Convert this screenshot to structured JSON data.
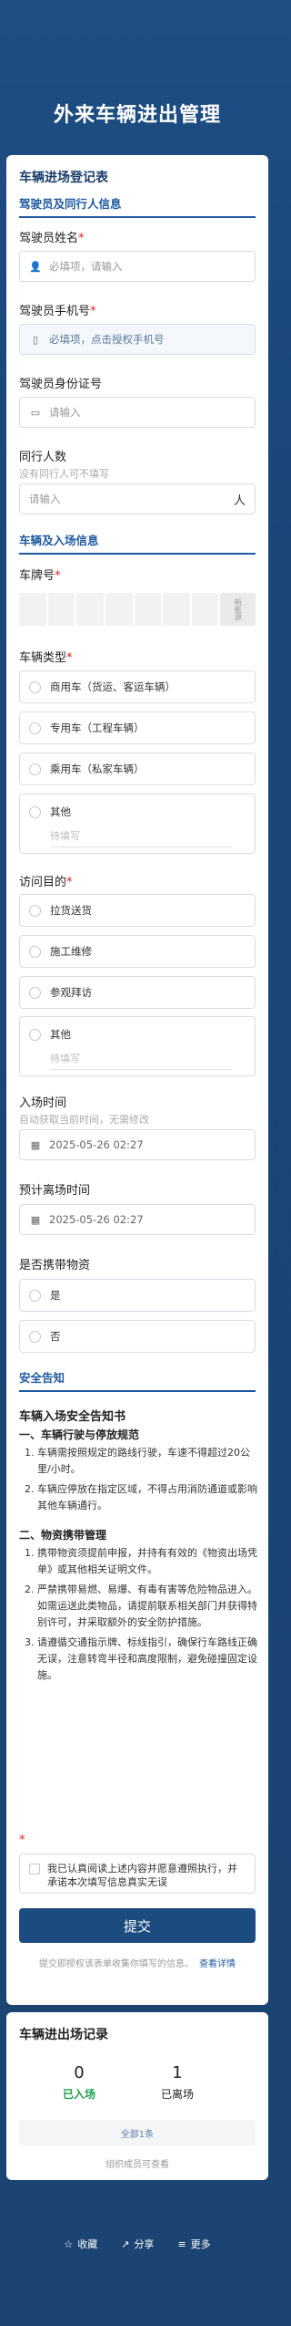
{
  "header": {
    "title": "外来车辆进出管理"
  },
  "form": {
    "title": "车辆进场登记表",
    "driver_section": "驾驶员及同行人信息",
    "name": {
      "label": "驾驶员姓名",
      "placeholder": "必填项，请输入"
    },
    "phone": {
      "label": "驾驶员手机号",
      "placeholder": "必填项，点击授权手机号"
    },
    "id_card": {
      "label": "驾驶员身份证号",
      "placeholder": "请输入"
    },
    "companions": {
      "label": "同行人数",
      "hint": "没有同行人可不填写",
      "placeholder": "请输入",
      "unit": "人"
    },
    "vehicle_section": "车辆及入场信息",
    "plate": {
      "label": "车牌号",
      "last_cell": "新能源"
    },
    "vehicle_type": {
      "label": "车辆类型",
      "options": [
        "商用车（货运、客运车辆）",
        "专用车（工程车辆）",
        "乘用车（私家车辆）"
      ],
      "other": "其他",
      "other_placeholder": "待填写"
    },
    "purpose": {
      "label": "访问目的",
      "options": [
        "拉货送货",
        "施工维修",
        "参观拜访"
      ],
      "other": "其他",
      "other_placeholder": "待填写"
    },
    "entry_time": {
      "label": "入场时间",
      "hint": "自动获取当前时间，无需修改",
      "value": "2025-05-26 02:27"
    },
    "leave_time": {
      "label": "预计离场时间",
      "value": "2025-05-26 02:27"
    },
    "goods": {
      "label": "是否携带物资",
      "yes": "是",
      "no": "否"
    },
    "notice_section": "安全告知",
    "notice": {
      "title": "车辆入场安全告知书",
      "s1": "一、车辆行驶与停放规范",
      "s1_items": [
        {
          "n": "1.",
          "t": "车辆需按照规定的路线行驶，车速不得超过20公里/小时。"
        },
        {
          "n": "2.",
          "t": "车辆应停放在指定区域，不得占用消防通道或影响其他车辆通行。"
        }
      ],
      "s2": "二、物资携带管理",
      "s2_items": [
        {
          "n": "1.",
          "t": "携带物资须提前申报，并持有有效的《物资出场凭单》或其他相关证明文件。"
        },
        {
          "n": "2.",
          "t": "严禁携带易燃、易爆、有毒有害等危险物品进入。如需运送此类物品，请提前联系相关部门并获得特别许可，并采取额外的安全防护措施。"
        },
        {
          "n": "3.",
          "t": "请遵循交通指示牌、标线指引，确保行车路线正确无误，注意转弯半径和高度限制，避免碰撞固定设施。"
        }
      ]
    },
    "agree_text": "我已认真阅读上述内容并愿意遵照执行，并承诺本次填写信息真实无误",
    "submit": "提交",
    "footer_note": "提交即授权该表单收集你填写的信息。",
    "footer_link": "查看详情"
  },
  "records": {
    "title": "车辆进出场记录",
    "entered_count": "0",
    "entered_label": "已入场",
    "left_count": "1",
    "left_label": "已离场",
    "all_label": "全部1条",
    "only_org": "组织成员可查看"
  },
  "bottom": {
    "fav": "收藏",
    "share": "分享",
    "more": "更多"
  },
  "colors": {
    "primary": "#1b4b7f",
    "accent": "#1f5aa0",
    "required": "#e02020",
    "entered": "#1e9e4e"
  }
}
